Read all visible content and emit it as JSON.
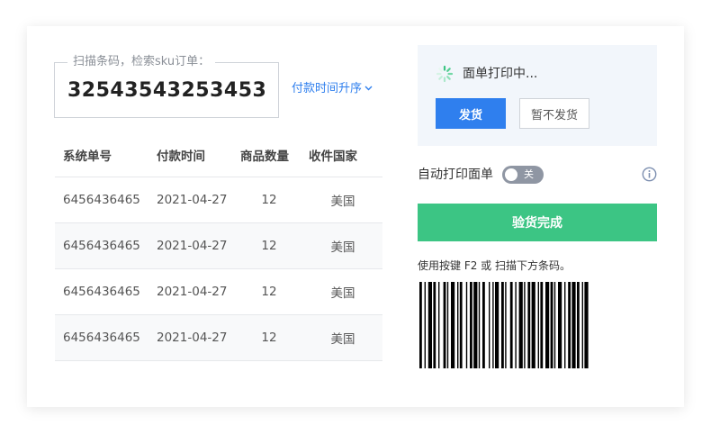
{
  "scan": {
    "legend": "扫描条码，检索sku订单：",
    "value": "32543543253453"
  },
  "sort_link": "付款时间升序",
  "table": {
    "headers": [
      "系统单号",
      "付款时间",
      "商品数量",
      "收件国家"
    ],
    "rows": [
      [
        "6456436465",
        "2021-04-27",
        "12",
        "美国"
      ],
      [
        "6456436465",
        "2021-04-27",
        "12",
        "美国"
      ],
      [
        "6456436465",
        "2021-04-27",
        "12",
        "美国"
      ],
      [
        "6456436465",
        "2021-04-27",
        "12",
        "美国"
      ]
    ]
  },
  "status": {
    "text": "面单打印中...",
    "ship_label": "发货",
    "hold_label": "暂不发货"
  },
  "auto_print": {
    "label": "自动打印面单",
    "toggle_label": "关"
  },
  "verify_label": "验货完成",
  "hint": "使用按键 F2 或 扫描下方条码。",
  "colors": {
    "primary": "#2f7fee",
    "success": "#3cc584",
    "status_bg": "#f2f6fb",
    "toggle_off": "#8f96a3"
  },
  "icons": {
    "spinner": "loading-spinner-icon",
    "chevron": "chevron-down-icon",
    "info": "info-circle-icon",
    "barcode": "barcode-icon"
  }
}
